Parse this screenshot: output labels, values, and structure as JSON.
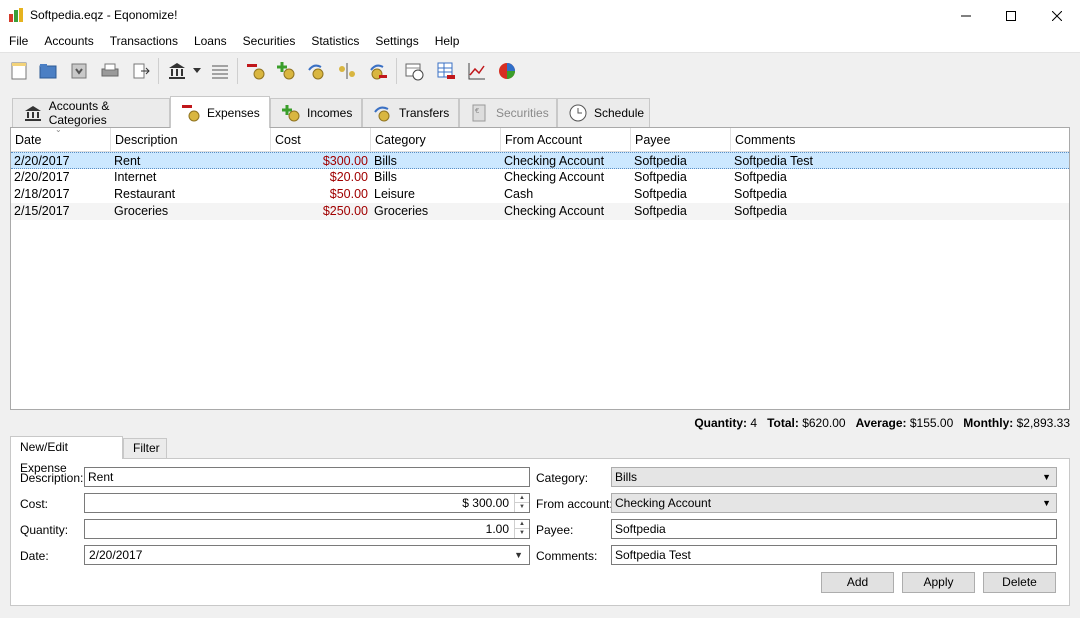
{
  "window": {
    "title": "Softpedia.eqz - Eqonomize!",
    "app_icon": "bar-chart-app-icon"
  },
  "menu": [
    "File",
    "Accounts",
    "Transactions",
    "Loans",
    "Securities",
    "Statistics",
    "Settings",
    "Help"
  ],
  "toolbar_icons": [
    "new-file-icon",
    "open-folder-icon",
    "save-icon",
    "print-icon",
    "export-icon",
    "bank-icon",
    "dropdown-icon",
    "ledger-icon",
    "new-expense-icon",
    "new-income-icon",
    "new-transfer-icon",
    "balance-icon",
    "refund-icon",
    "schedule-icon",
    "categories-table-icon",
    "line-chart-icon",
    "pie-chart-icon"
  ],
  "tabs": [
    {
      "label": "Accounts & Categories",
      "icon": "bank-icon"
    },
    {
      "label": "Expenses",
      "icon": "expense-coins-icon"
    },
    {
      "label": "Incomes",
      "icon": "income-coins-icon"
    },
    {
      "label": "Transfers",
      "icon": "transfer-coins-icon"
    },
    {
      "label": "Securities",
      "icon": "securities-icon"
    },
    {
      "label": "Schedule",
      "icon": "clock-icon"
    }
  ],
  "table": {
    "columns": [
      "Date",
      "Description",
      "Cost",
      "Category",
      "From Account",
      "Payee",
      "Comments"
    ],
    "rows": [
      {
        "date": "2/20/2017",
        "description": "Rent",
        "cost": "$300.00",
        "category": "Bills",
        "from_account": "Checking Account",
        "payee": "Softpedia",
        "comments": "Softpedia Test"
      },
      {
        "date": "2/20/2017",
        "description": "Internet",
        "cost": "$20.00",
        "category": "Bills",
        "from_account": "Checking Account",
        "payee": "Softpedia",
        "comments": "Softpedia"
      },
      {
        "date": "2/18/2017",
        "description": "Restaurant",
        "cost": "$50.00",
        "category": "Leisure",
        "from_account": "Cash",
        "payee": "Softpedia",
        "comments": "Softpedia"
      },
      {
        "date": "2/15/2017",
        "description": "Groceries",
        "cost": "$250.00",
        "category": "Groceries",
        "from_account": "Checking Account",
        "payee": "Softpedia",
        "comments": "Softpedia"
      }
    ]
  },
  "summary": {
    "quantity_label": "Quantity:",
    "quantity": "4",
    "total_label": "Total:",
    "total": "$620.00",
    "average_label": "Average:",
    "average": "$155.00",
    "monthly_label": "Monthly:",
    "monthly": "$2,893.33"
  },
  "subtabs": [
    "New/Edit Expense",
    "Filter"
  ],
  "form": {
    "description_label": "Description:",
    "description": "Rent",
    "cost_label": "Cost:",
    "cost": "$ 300.00",
    "quantity_label": "Quantity:",
    "quantity": "1.00",
    "date_label": "Date:",
    "date": "2/20/2017",
    "category_label": "Category:",
    "category": "Bills",
    "from_account_label": "From account:",
    "from_account": "Checking Account",
    "payee_label": "Payee:",
    "payee": "Softpedia",
    "comments_label": "Comments:",
    "comments": "Softpedia Test"
  },
  "buttons": {
    "add": "Add",
    "apply": "Apply",
    "delete": "Delete"
  },
  "colors": {
    "selection": "#cce8ff",
    "cost_text": "#a00000"
  }
}
